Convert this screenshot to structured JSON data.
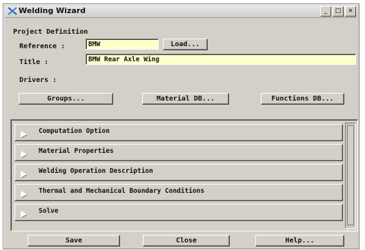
{
  "window": {
    "title": "Welding Wizard",
    "buttons": [
      "_",
      "□",
      "×"
    ]
  },
  "project": {
    "heading": "Project Definition",
    "reference_label": "Reference :",
    "reference_value": "BMW",
    "load_label": "Load...",
    "title_label": "Title :",
    "title_value": "BMW Rear Axle Wing",
    "drivers_label": "Drivers :"
  },
  "drivers": {
    "groups_label": "Groups...",
    "material_label": "Material DB...",
    "functions_label": "Functions DB..."
  },
  "sections": [
    "Computation Option",
    "Material Properties",
    "Welding Operation Description",
    "Thermal and Mechanical Boundary Conditions",
    "Solve"
  ],
  "footer": {
    "save_label": "Save",
    "close_label": "Close",
    "help_label": "Help..."
  }
}
